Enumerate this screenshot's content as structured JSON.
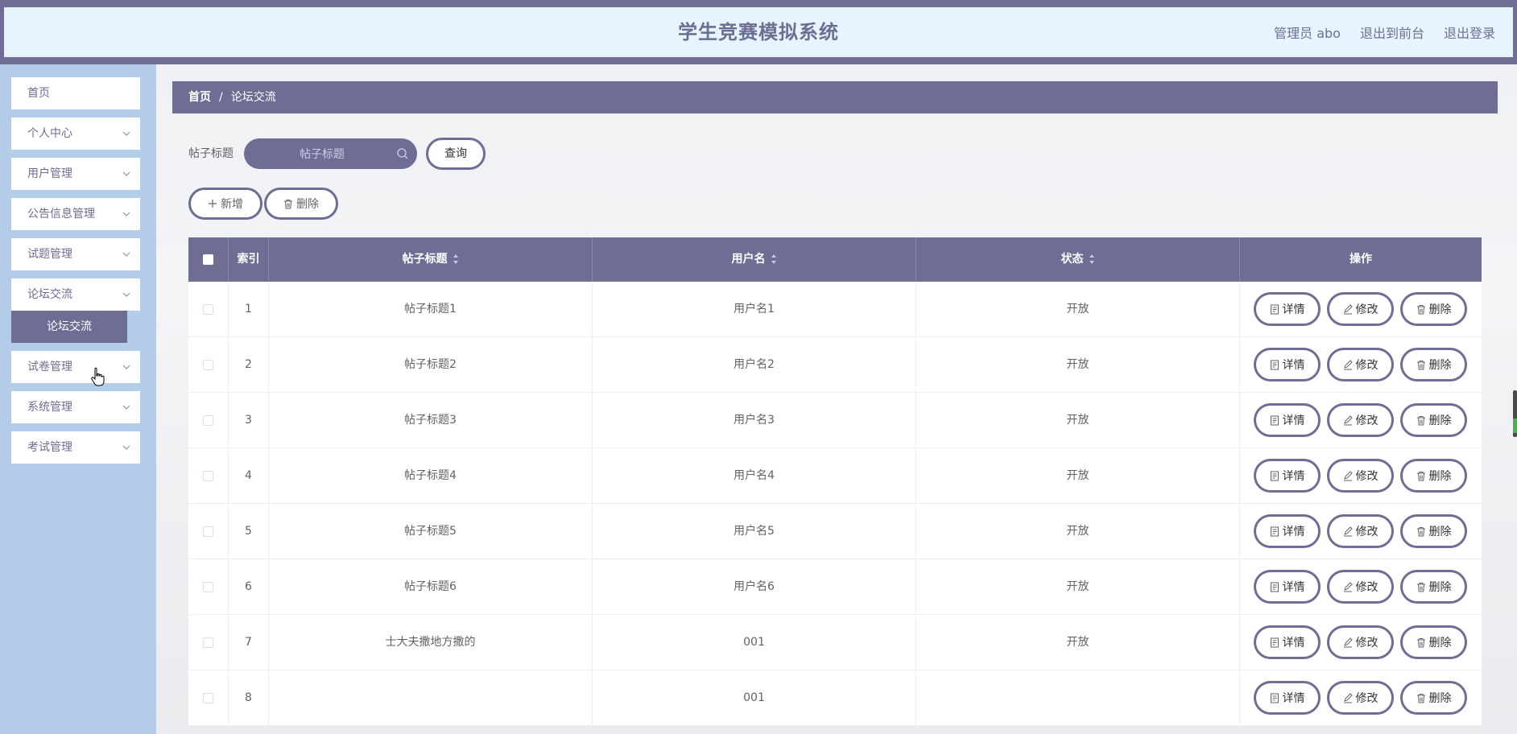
{
  "header": {
    "title": "学生竞赛模拟系统",
    "admin_label": "管理员 abo",
    "to_front_label": "退出到前台",
    "logout_label": "退出登录"
  },
  "sidebar": {
    "items": [
      {
        "label": "首页",
        "expandable": false
      },
      {
        "label": "个人中心",
        "expandable": true
      },
      {
        "label": "用户管理",
        "expandable": true
      },
      {
        "label": "公告信息管理",
        "expandable": true
      },
      {
        "label": "试题管理",
        "expandable": true
      },
      {
        "label": "论坛交流",
        "expandable": true
      },
      {
        "label": "试卷管理",
        "expandable": true
      },
      {
        "label": "系统管理",
        "expandable": true
      },
      {
        "label": "考试管理",
        "expandable": true
      }
    ],
    "submenu_label": "论坛交流"
  },
  "breadcrumb": {
    "home": "首页",
    "separator": "/",
    "current": "论坛交流"
  },
  "search": {
    "label": "帖子标题",
    "placeholder": "帖子标题",
    "query_label": "查询"
  },
  "actions": {
    "add_label": "新增",
    "delete_label": "删除"
  },
  "table": {
    "headers": {
      "index": "索引",
      "title": "帖子标题",
      "username": "用户名",
      "status": "状态",
      "operation": "操作"
    },
    "row_actions": {
      "detail": "详情",
      "edit": "修改",
      "delete": "删除"
    },
    "rows": [
      {
        "index": "1",
        "title": "帖子标题1",
        "username": "用户名1",
        "status": "开放"
      },
      {
        "index": "2",
        "title": "帖子标题2",
        "username": "用户名2",
        "status": "开放"
      },
      {
        "index": "3",
        "title": "帖子标题3",
        "username": "用户名3",
        "status": "开放"
      },
      {
        "index": "4",
        "title": "帖子标题4",
        "username": "用户名4",
        "status": "开放"
      },
      {
        "index": "5",
        "title": "帖子标题5",
        "username": "用户名5",
        "status": "开放"
      },
      {
        "index": "6",
        "title": "帖子标题6",
        "username": "用户名6",
        "status": "开放"
      },
      {
        "index": "7",
        "title": "士大夫撒地方撒的",
        "username": "001",
        "status": "开放"
      },
      {
        "index": "8",
        "title": "",
        "username": "001",
        "status": ""
      }
    ]
  },
  "colors": {
    "primary": "#6e6d93",
    "sidebar_bg": "#b3cde9",
    "header_bg": "#e6f4fd"
  }
}
